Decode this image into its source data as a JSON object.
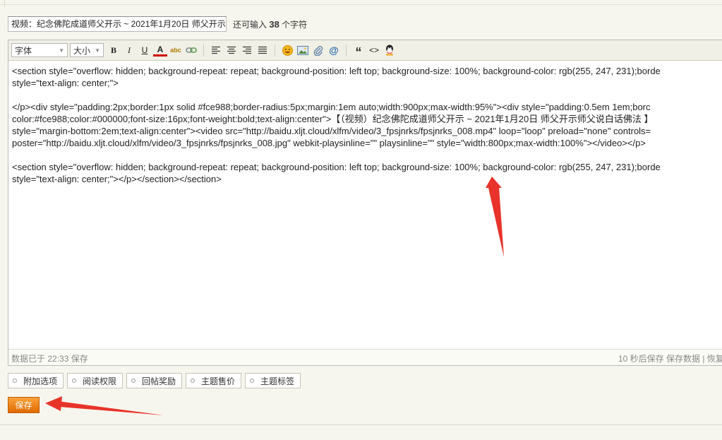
{
  "title_input": {
    "value": "视频：纪念佛陀成道师父开示 ~ 2021年1月20日 师父开示"
  },
  "remaining": {
    "prefix": "还可输入",
    "count": "38",
    "suffix": "个字符"
  },
  "toolbar": {
    "font_label": "字体",
    "size_label": "大小",
    "bold": "B",
    "italic": "I",
    "underline": "U",
    "font_color": "A",
    "spell": "abc",
    "quote": "“",
    "code": "<>",
    "icons": [
      "bold-icon",
      "italic-icon",
      "underline-icon",
      "font-color-icon",
      "spellcheck-icon",
      "link-icon",
      "align-left-icon",
      "align-center-icon",
      "align-right-icon",
      "justify-icon",
      "emoji-icon",
      "image-icon",
      "attachment-icon",
      "at-icon",
      "quote-icon",
      "code-icon",
      "qq-icon"
    ]
  },
  "editor": {
    "lines": [
      "<section style=\"overflow: hidden; background-repeat: repeat; background-position: left top; background-size: 100%; background-color: rgb(255, 247, 231);borde",
      "style=\"text-align: center;\">",
      "",
      "</p><div style=\"padding:2px;border:1px solid #fce988;border-radius:5px;margin:1em auto;width:900px;max-width:95%\"><div style=\"padding:0.5em 1em;borc",
      "color:#fce988;color:#000000;font-size:16px;font-weight:bold;text-align:center\">【（视频）纪念佛陀成道师父开示 ~ 2021年1月20日 师父开示师父说白话佛法 】",
      "style=\"margin-bottom:2em;text-align:center\"><video src=\"http://baidu.xljt.cloud/xlfm/video/3_fpsjnrks/fpsjnrks_008.mp4\" loop=\"loop\" preload=\"none\" controls=",
      "poster=\"http://baidu.xljt.cloud/xlfm/video/3_fpsjnrks/fpsjnrks_008.jpg\" webkit-playsinline=\"\" playsinline=\"\" style=\"width:800px;max-width:100%\"></video></p>",
      "",
      "<section style=\"overflow: hidden; background-repeat: repeat; background-position: left top; background-size: 100%; background-color: rgb(255, 247, 231);borde",
      "style=\"text-align: center;\"></p></section></section>"
    ]
  },
  "status": {
    "left": "数据已于 22:33 保存",
    "right": "10 秒后保存  保存数据 | 恢复"
  },
  "options": [
    "附加选项",
    "阅读权限",
    "回帖奖励",
    "主题售价",
    "主题标签"
  ],
  "save_label": "保存",
  "colors": {
    "accent": "#e8790d",
    "annotation_arrow": "#e8332a",
    "page_bg": "#f7f6ee"
  }
}
